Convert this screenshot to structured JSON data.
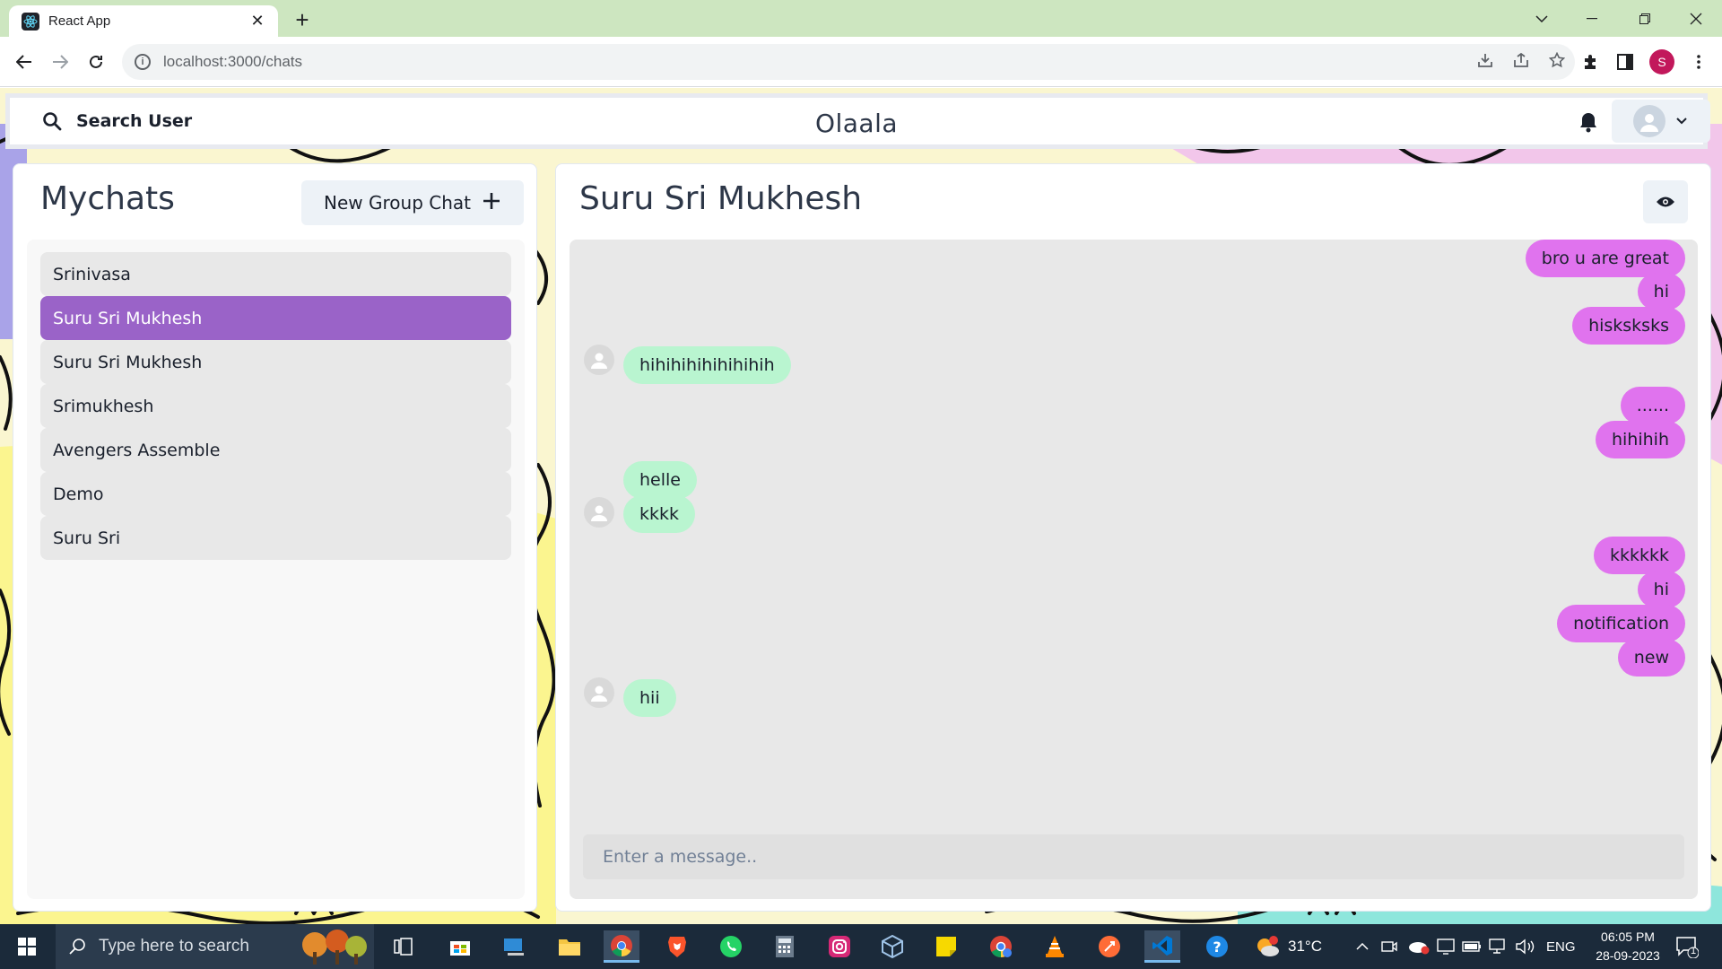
{
  "browser": {
    "tab_title": "React App",
    "url": "localhost:3000/chats",
    "profile_initial": "S"
  },
  "app": {
    "search_label": "Search User",
    "brand": "Olaala"
  },
  "mychats": {
    "title": "Mychats",
    "new_group_label": "New Group Chat",
    "items": [
      {
        "name": "Srinivasa",
        "active": false
      },
      {
        "name": "Suru Sri Mukhesh",
        "active": true
      },
      {
        "name": "Suru Sri Mukhesh",
        "active": false
      },
      {
        "name": "Srimukhesh",
        "active": false
      },
      {
        "name": "Avengers Assemble",
        "active": false
      },
      {
        "name": "Demo",
        "active": false
      },
      {
        "name": "Suru Sri",
        "active": false
      }
    ]
  },
  "chat": {
    "title": "Suru Sri Mukhesh",
    "input_placeholder": "Enter a message..",
    "messages": [
      {
        "text": "bro u are great",
        "mine": true
      },
      {
        "text": "hi",
        "mine": true
      },
      {
        "text": "hisksksks",
        "mine": true
      },
      {
        "text": "hihihihihihihihih",
        "mine": false,
        "avatar": true
      },
      {
        "text": "......",
        "mine": true
      },
      {
        "text": "hihihih",
        "mine": true
      },
      {
        "text": "helle",
        "mine": false,
        "avatar": false
      },
      {
        "text": "kkkk",
        "mine": false,
        "avatar": true
      },
      {
        "text": "kkkkkk",
        "mine": true
      },
      {
        "text": "hi",
        "mine": true
      },
      {
        "text": "notification",
        "mine": true
      },
      {
        "text": "new",
        "mine": true
      },
      {
        "text": "hii",
        "mine": false,
        "avatar": true
      }
    ]
  },
  "taskbar": {
    "search_placeholder": "Type here to search",
    "weather": "31°C",
    "language": "ENG",
    "time": "06:05 PM",
    "date": "28-09-2023",
    "notification_count": "1"
  },
  "colors": {
    "active_chat": "#9a63c8",
    "my_bubble": "#e073ee",
    "their_bubble": "#b9f5d0"
  }
}
